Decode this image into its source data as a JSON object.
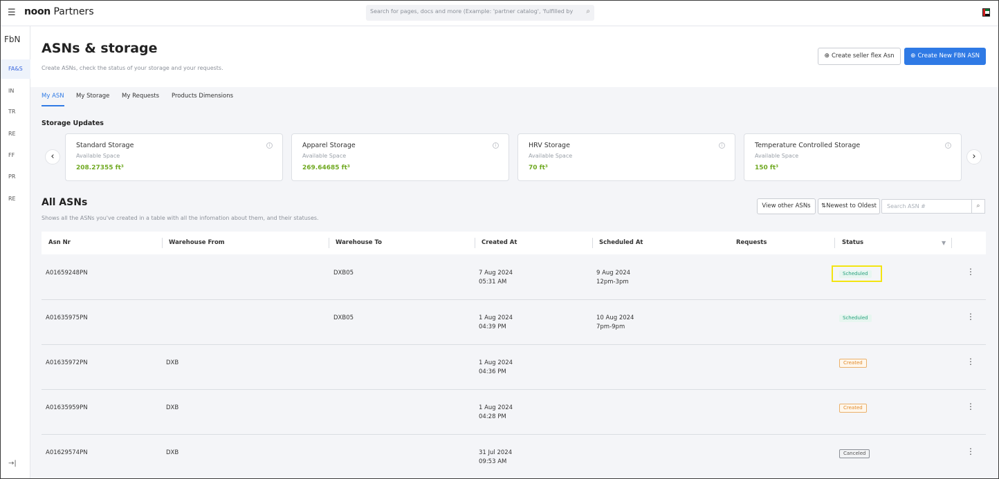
{
  "topbar": {
    "brand_bold": "noon",
    "brand_rest": "Partners",
    "search_placeholder": "Search for pages, docs and more (Example: 'partner catalog', 'fulfilled by p"
  },
  "sidebar": {
    "title": "FbN",
    "items": [
      {
        "label": "FA&S",
        "active": true
      },
      {
        "label": "IN"
      },
      {
        "label": "TR"
      },
      {
        "label": "RE"
      },
      {
        "label": "FF"
      },
      {
        "label": "PR"
      },
      {
        "label": "RE"
      }
    ],
    "collapse_glyph": "→|"
  },
  "header": {
    "title": "ASNs & storage",
    "subtitle": "Create ASNs, check the status of your storage and your requests.",
    "btn_seller_flex": "Create seller flex Asn",
    "btn_fbn": "Create New FBN ASN"
  },
  "tabs": [
    "My ASN",
    "My Storage",
    "My Requests",
    "Products Dimensions"
  ],
  "storage": {
    "title": "Storage Updates",
    "cards": [
      {
        "name": "Standard Storage",
        "sub": "Available Space",
        "value": "208.27355 ft³"
      },
      {
        "name": "Apparel Storage",
        "sub": "Available Space",
        "value": "269.64685 ft³"
      },
      {
        "name": "HRV Storage",
        "sub": "Available Space",
        "value": "70 ft³"
      },
      {
        "name": "Temperature Controlled Storage",
        "sub": "Available Space",
        "value": "150 ft³"
      }
    ]
  },
  "asns": {
    "title": "All ASNs",
    "subtitle": "Shows all the ASNs you've created in a table with all the infomation about them, and their statuses.",
    "btn_view_other": "View other ASNs",
    "btn_sort": "⇅Newest to Oldest",
    "search_placeholder": "Search ASN #",
    "columns": [
      "Asn Nr",
      "Warehouse From",
      "Warehouse To",
      "Created At",
      "Scheduled At",
      "Requests",
      "Status"
    ],
    "rows": [
      {
        "asn": "A01659248PN",
        "from": "",
        "to": "DXB05",
        "created_date": "7 Aug 2024",
        "created_time": "05:31 AM",
        "sched_date": "9 Aug 2024",
        "sched_time": "12pm-3pm",
        "status": "Scheduled"
      },
      {
        "asn": "A01635975PN",
        "from": "",
        "to": "DXB05",
        "created_date": "1 Aug 2024",
        "created_time": "04:39 PM",
        "sched_date": "10 Aug 2024",
        "sched_time": "7pm-9pm",
        "status": "Scheduled"
      },
      {
        "asn": "A01635972PN",
        "from": "DXB",
        "to": "",
        "created_date": "1 Aug 2024",
        "created_time": "04:36 PM",
        "sched_date": "",
        "sched_time": "",
        "status": "Created"
      },
      {
        "asn": "A01635959PN",
        "from": "DXB",
        "to": "",
        "created_date": "1 Aug 2024",
        "created_time": "04:28 PM",
        "sched_date": "",
        "sched_time": "",
        "status": "Created"
      },
      {
        "asn": "A01629574PN",
        "from": "DXB",
        "to": "",
        "created_date": "31 Jul 2024",
        "created_time": "09:53 AM",
        "sched_date": "",
        "sched_time": "",
        "status": "Canceled"
      }
    ]
  },
  "colors": {
    "primary": "#2f7ae5",
    "storage_value": "#6ea81f",
    "scheduled": "#26a07d",
    "created": "#e08a2b",
    "highlight": "#f3e411"
  }
}
